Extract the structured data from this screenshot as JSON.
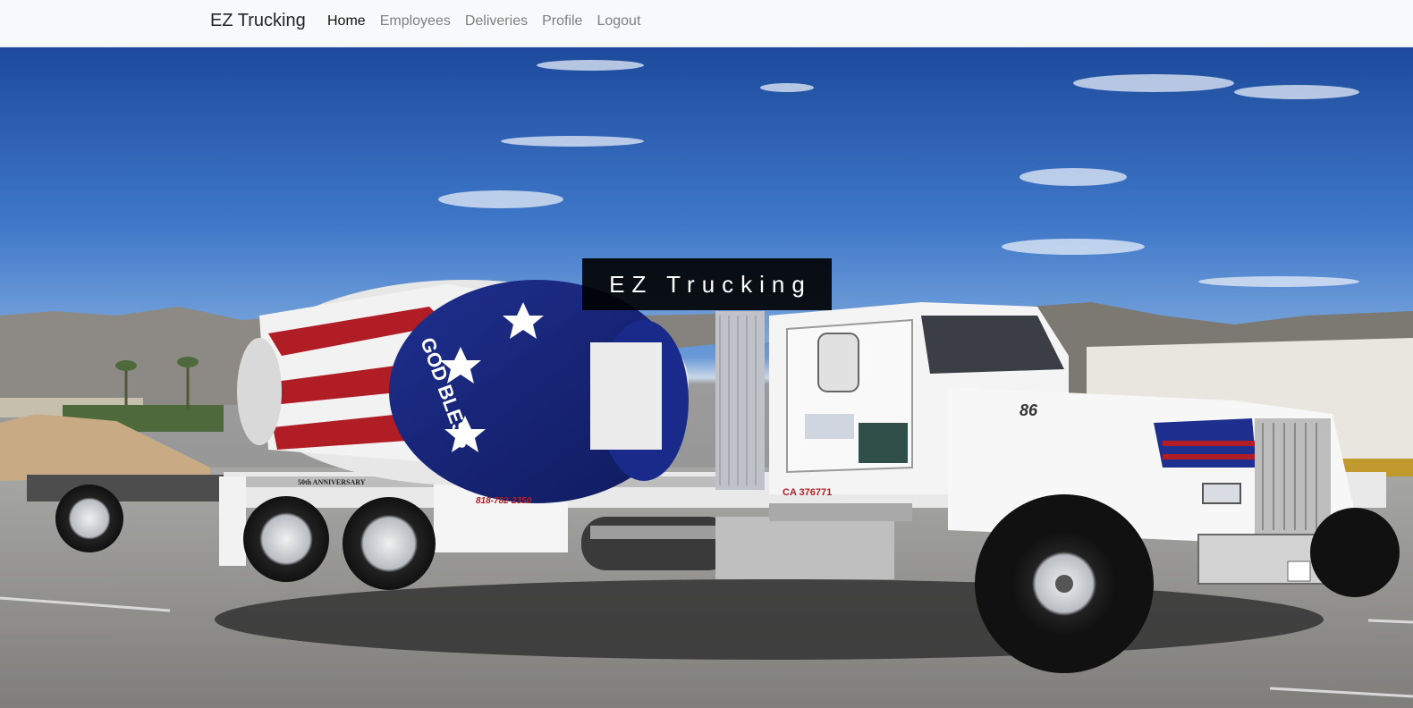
{
  "navbar": {
    "brand": "EZ Trucking",
    "links": [
      {
        "label": "Home",
        "active": true
      },
      {
        "label": "Employees",
        "active": false
      },
      {
        "label": "Deliveries",
        "active": false
      },
      {
        "label": "Profile",
        "active": false
      },
      {
        "label": "Logout",
        "active": false
      }
    ]
  },
  "hero": {
    "title": "EZ Trucking",
    "image_subject": "cement mixer truck with american flag paint",
    "truck_text": {
      "drum_text": "GOD BLESS",
      "anniversary": "50th ANNIVERSARY",
      "phone": "818-782-2350",
      "plate": "CA 376771",
      "model": "86"
    }
  },
  "colors": {
    "navbar_bg": "#f8f9fa",
    "brand": "#212529",
    "nav_link": "#7f7f7f",
    "nav_active": "#111111",
    "title_box_bg": "#000000",
    "title_text": "#ffffff"
  }
}
